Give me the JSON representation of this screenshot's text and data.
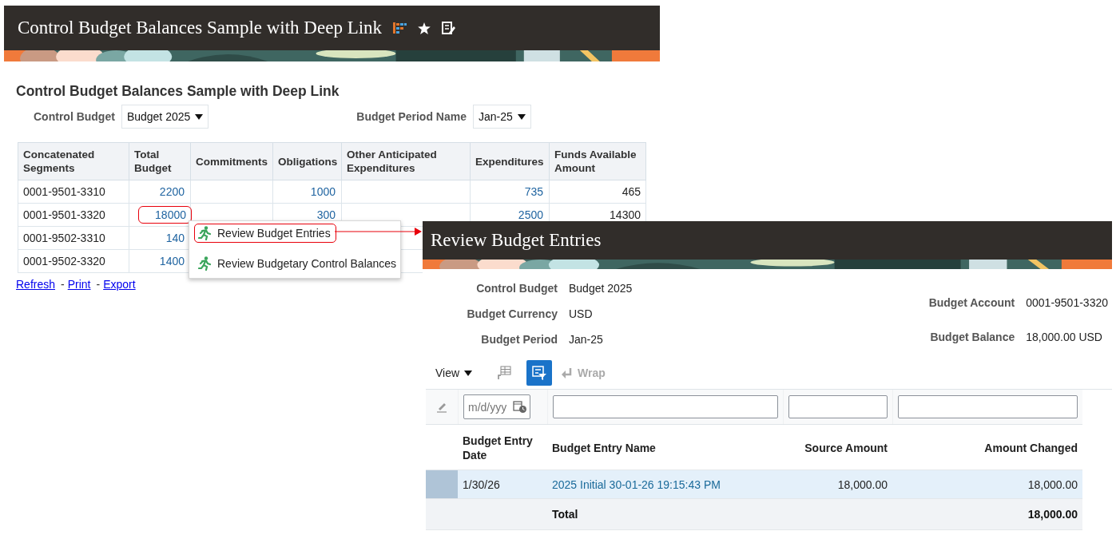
{
  "report_window": {
    "title": "Control Budget Balances Sample with Deep Link",
    "heading": "Control Budget Balances Sample with Deep Link",
    "parameters": [
      {
        "label": "Control Budget",
        "value": "Budget 2025"
      },
      {
        "label": "Budget Period Name",
        "value": "Jan-25"
      }
    ],
    "table": {
      "columns": [
        "Concatenated Segments",
        "Total Budget",
        "Commitments",
        "Obligations",
        "Other Anticipated Expenditures",
        "Expenditures",
        "Funds Available Amount"
      ],
      "rows": [
        {
          "circled": false,
          "cells": [
            "0001-9501-3310",
            "2200",
            null,
            "1000",
            null,
            "735",
            "465"
          ]
        },
        {
          "circled": true,
          "cells": [
            "0001-9501-3320",
            "18000",
            null,
            "300",
            null,
            "2500",
            "14300"
          ]
        },
        {
          "circled": false,
          "cells": [
            "0001-9502-3310",
            "140"
          ]
        },
        {
          "circled": false,
          "cells": [
            "0001-9502-3320",
            "1400"
          ]
        }
      ]
    },
    "links": [
      "Refresh",
      "Print",
      "Export"
    ],
    "link_separator": "-"
  },
  "context_menu": {
    "items": [
      {
        "label": "Review Budget Entries",
        "highlighted": true
      },
      {
        "label": "Review Budgetary Control Balances",
        "highlighted": false
      }
    ]
  },
  "entries_window": {
    "title": "Review Budget Entries",
    "left_fields": [
      {
        "label": "Control Budget",
        "value": "Budget 2025"
      },
      {
        "label": "Budget Currency",
        "value": "USD"
      },
      {
        "label": "Budget Period",
        "value": "Jan-25"
      }
    ],
    "right_fields": [
      {
        "label": "Budget Account",
        "value": "0001-9501-3320"
      },
      {
        "label": "Budget Balance",
        "value": "18,000.00 USD"
      }
    ],
    "toolbar": [
      {
        "kind": "view-menu",
        "label": "View"
      },
      {
        "kind": "freeze",
        "selected": false
      },
      {
        "kind": "query-by-example",
        "selected": true
      },
      {
        "kind": "wrap",
        "label": "Wrap",
        "disabled": true
      }
    ],
    "filter_date_placeholder": "m/d/yyy",
    "table": {
      "columns": [
        "Budget Entry Date",
        "Budget Entry Name",
        "Source Amount",
        "Amount Changed"
      ],
      "rows": [
        {
          "selected": true,
          "date": "1/30/26",
          "name": "2025 Initial 30-01-26 19:15:43 PM",
          "source": "18,000.00",
          "changed": "18,000.00"
        }
      ],
      "total": {
        "label": "Total",
        "amount": "18,000.00"
      }
    }
  }
}
